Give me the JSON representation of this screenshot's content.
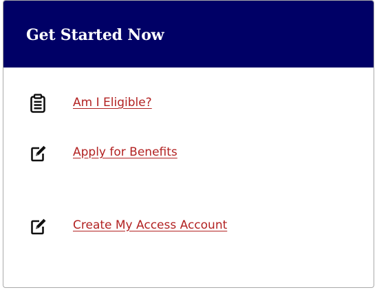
{
  "panel": {
    "title": "Get Started Now",
    "header_color": "#000066",
    "link_color": "#b22222"
  },
  "links": [
    {
      "label": "Am I Eligible?",
      "icon": "clipboard-icon"
    },
    {
      "label": "Apply for Benefits",
      "icon": "edit-icon"
    },
    {
      "label": "Create My Access Account",
      "icon": "edit-icon"
    }
  ]
}
